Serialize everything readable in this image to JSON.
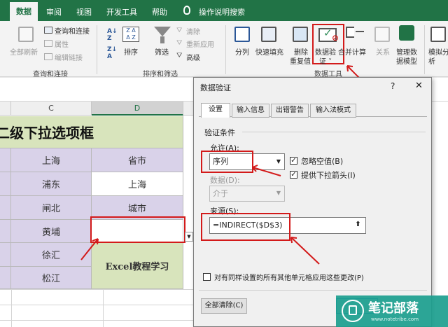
{
  "tabs": [
    "数据",
    "审阅",
    "视图",
    "开发工具",
    "帮助",
    "操作说明搜索"
  ],
  "ribbon": {
    "refresh_all": "全部刷新",
    "query_connect": "查询和连接",
    "properties": "属性",
    "edit_links": "编辑链接",
    "group_query": "查询和连接",
    "sort": "排序",
    "filter": "筛选",
    "clear": "清除",
    "reapply": "重新应用",
    "advanced": "高级",
    "group_sort": "排序和筛选",
    "split": "分列",
    "flash_fill": "快速填充",
    "remove_dup": [
      "删除",
      "重复值"
    ],
    "data_validation": [
      "数据验",
      "证 ˅"
    ],
    "consolidate": "合并计算",
    "relations": "关系",
    "manage_model": [
      "管理数",
      "据模型"
    ],
    "what_if": [
      "模拟分",
      "析"
    ],
    "group_tools": "数据工具"
  },
  "sheet": {
    "col_c": "C",
    "col_d": "D",
    "title": "二级下拉选项框",
    "c_cells": [
      "上海",
      "浦东",
      "闸北",
      "黄埔",
      "徐汇",
      "松江"
    ],
    "d_cells": [
      "省市",
      "上海",
      "城市",
      "",
      "",
      ""
    ],
    "watermark": "Excel教程学习"
  },
  "dialog": {
    "title": "数据验证",
    "help": "?",
    "close": "✕",
    "tabs": [
      "设置",
      "输入信息",
      "出错警告",
      "输入法模式"
    ],
    "section": "验证条件",
    "allow_label": "允许(A):",
    "allow_value": "序列",
    "ignore_blank": "忽略空值(B)",
    "dropdown": "提供下拉箭头(I)",
    "data_label": "数据(D):",
    "data_value": "介于",
    "source_label": "来源(S):",
    "source_value": "=INDIRECT($D$3)",
    "apply_all": "对有同样设置的所有其他单元格应用这些更改(P)",
    "clear_all": "全部清除(C)"
  },
  "logo": {
    "name": "笔记部落",
    "url": "www.notetribe.com"
  }
}
